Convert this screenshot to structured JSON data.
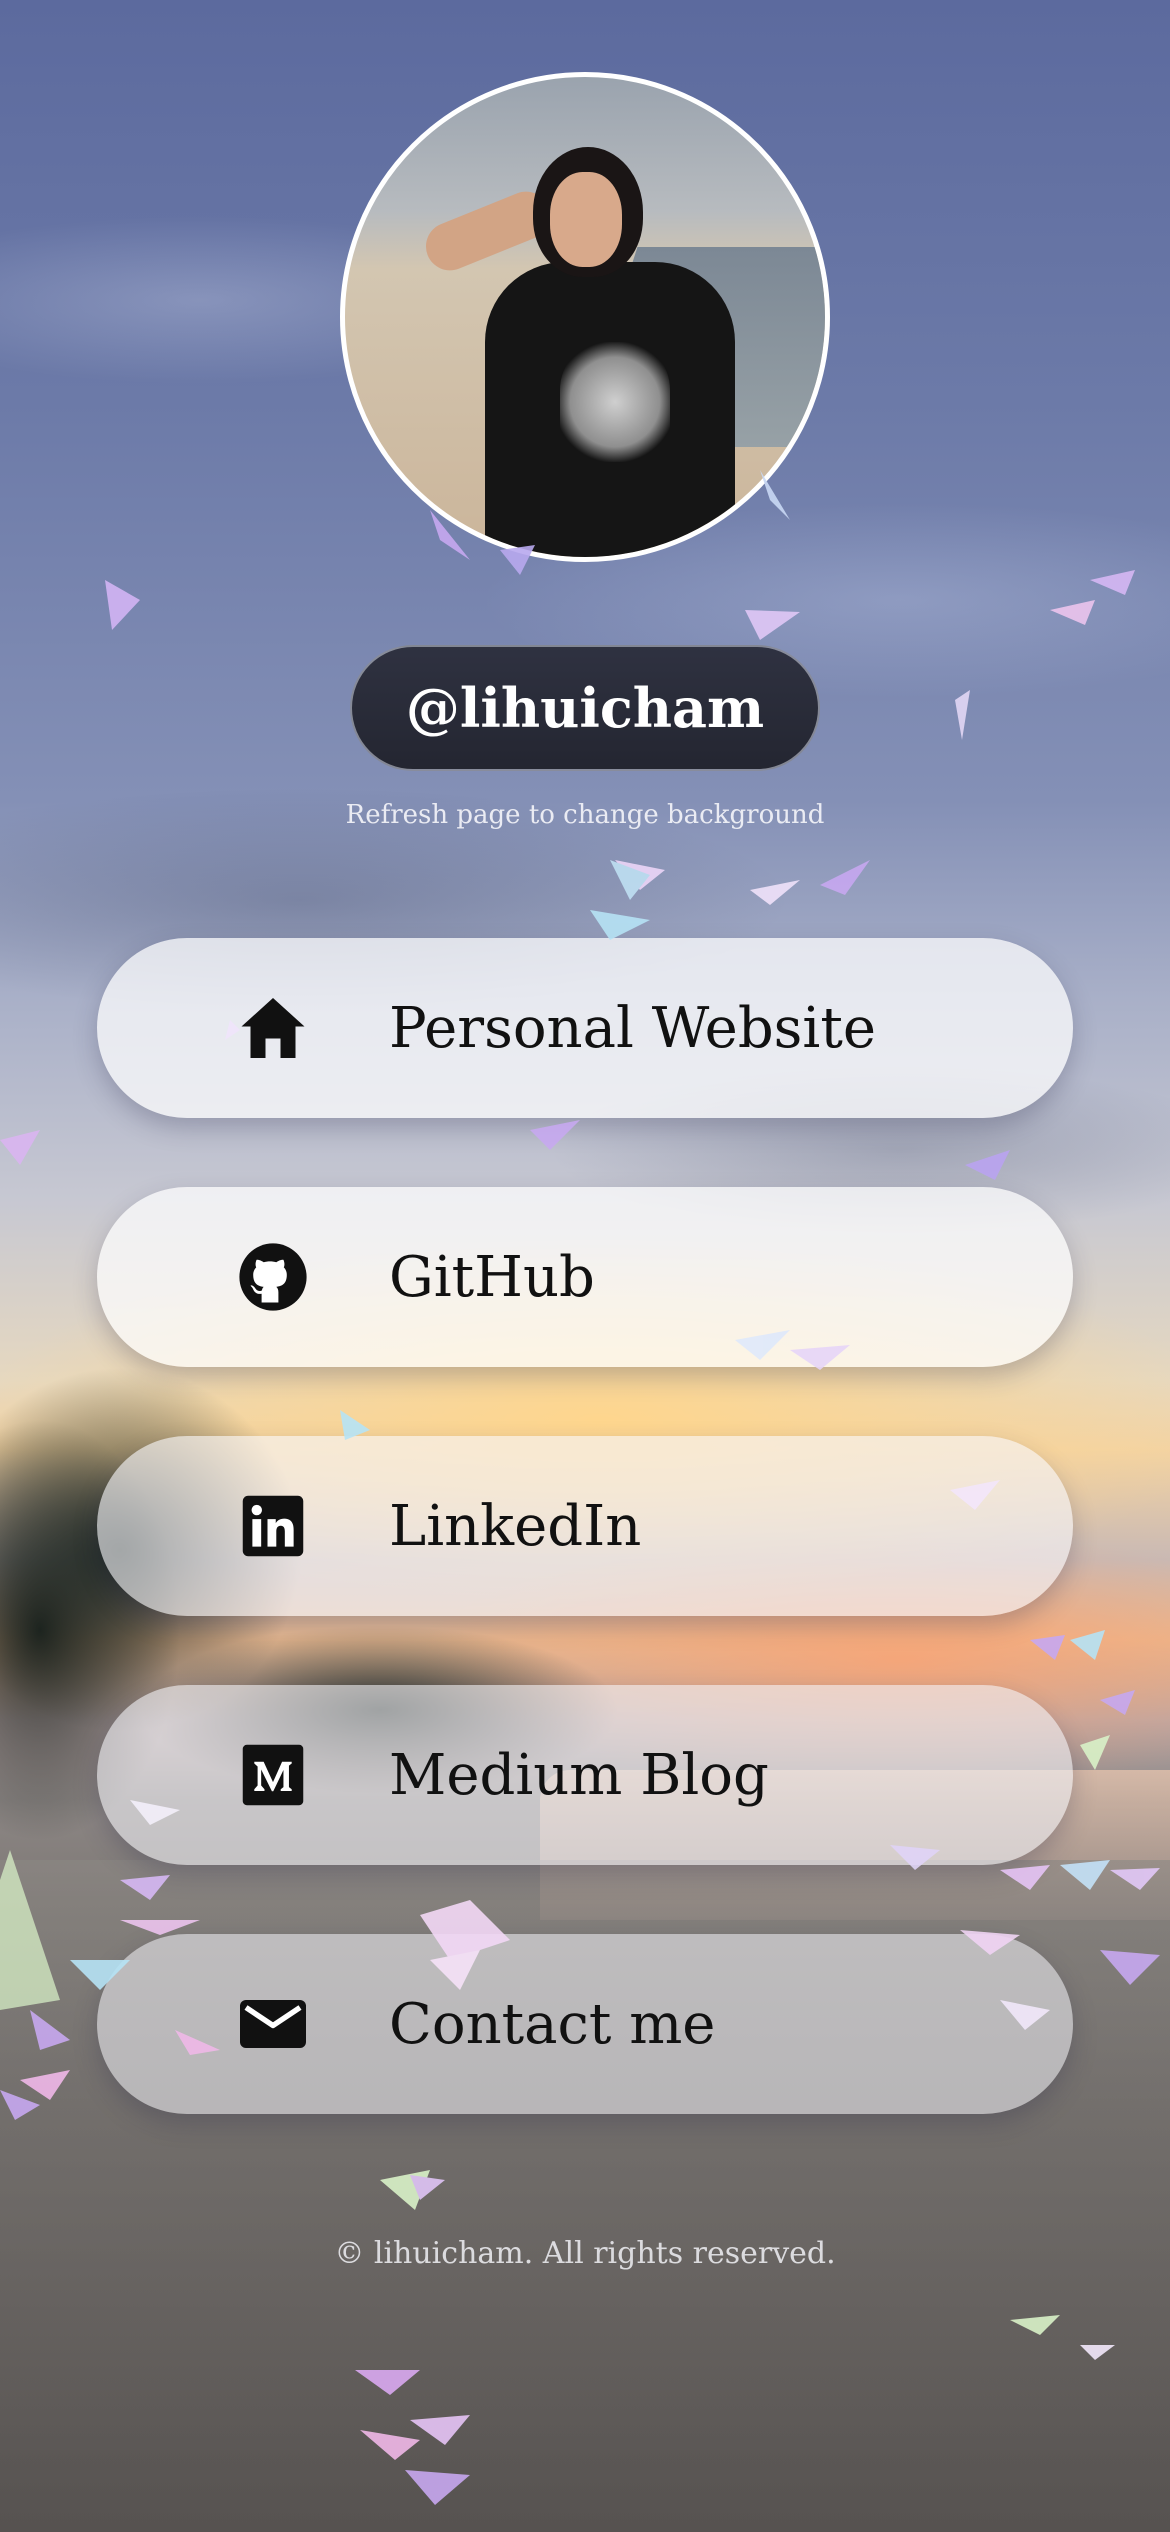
{
  "profile": {
    "handle": "@lihuicham",
    "avatar_alt": "Profile photo on a beach",
    "hint": "Refresh page to change background"
  },
  "links": [
    {
      "label": "Personal Website",
      "icon": "home-icon"
    },
    {
      "label": "GitHub",
      "icon": "github-icon"
    },
    {
      "label": "LinkedIn",
      "icon": "linkedin-icon"
    },
    {
      "label": "Medium Blog",
      "icon": "medium-icon"
    },
    {
      "label": "Contact me",
      "icon": "mail-icon"
    }
  ],
  "footer": {
    "text": "© lihuicham. All rights reserved."
  },
  "colors": {
    "pill_dark": "#26283a",
    "link_bg": "#ffffffb8",
    "text_dark": "#111111",
    "confetti": [
      "#c7a8f0",
      "#b6e3f5",
      "#f0b8e8",
      "#d9f2c8"
    ]
  }
}
